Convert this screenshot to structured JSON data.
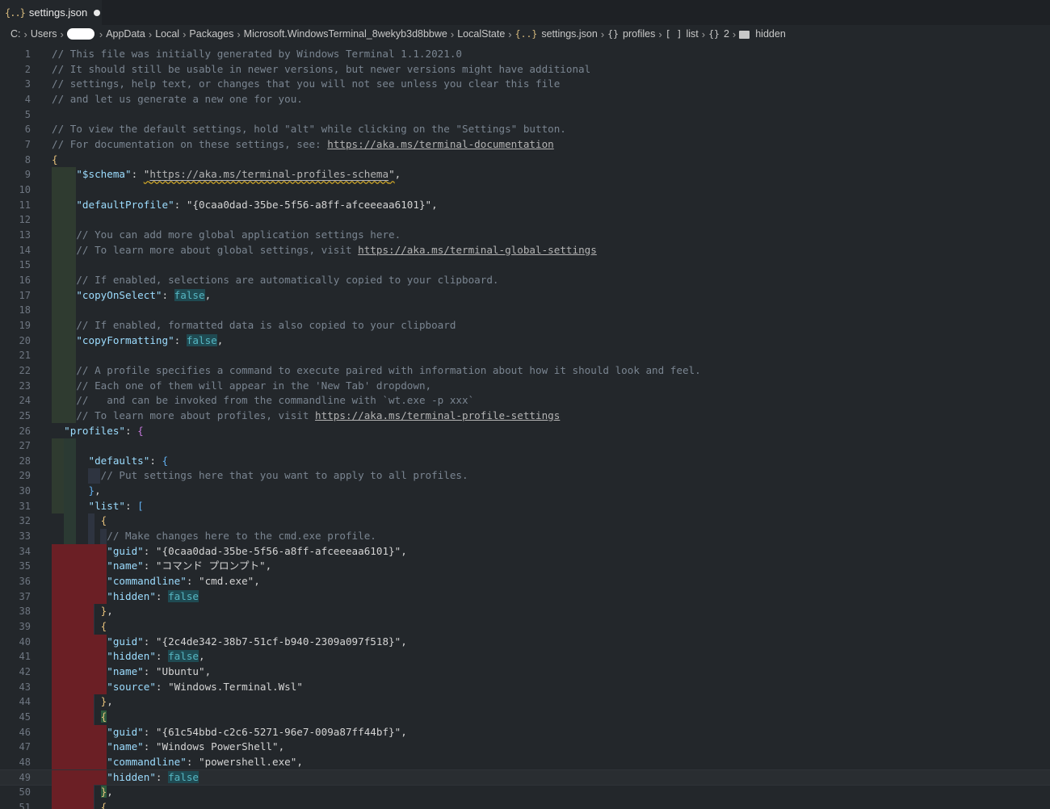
{
  "tab": {
    "icon": "{..}",
    "title": "settings.json"
  },
  "breadcrumb": {
    "drive": "C:",
    "users": "Users",
    "appdata": "AppData",
    "local": "Local",
    "packages": "Packages",
    "package": "Microsoft.WindowsTerminal_8wekyb3d8bbwe",
    "localstate": "LocalState",
    "file_icon": "{..}",
    "file": "settings.json",
    "obj_icon": "{}",
    "profiles": "profiles",
    "arr_icon": "[ ]",
    "list": "list",
    "obj2_icon": "{}",
    "index": "2",
    "hidden": "hidden"
  },
  "lines": [
    {
      "n": "1",
      "html": "<span class='c'>// This file was initially generated by Windows Terminal 1.1.2021.0</span>"
    },
    {
      "n": "2",
      "html": "<span class='c'>// It should still be usable in newer versions, but newer versions might have additional</span>"
    },
    {
      "n": "3",
      "html": "<span class='c'>// settings, help text, or changes that you will not see unless you clear this file</span>"
    },
    {
      "n": "4",
      "html": "<span class='c'>// and let us generate a new one for you.</span>"
    },
    {
      "n": "5",
      "html": ""
    },
    {
      "n": "6",
      "html": "<span class='c'>// To view the default settings, hold \"alt\" while clicking on the \"Settings\" button.</span>"
    },
    {
      "n": "7",
      "html": "<span class='c'>// For documentation on these settings, see: <span class='u'>https://aka.ms/terminal-documentation</span></span>"
    },
    {
      "n": "8",
      "html": "<span class='b'>{</span>"
    },
    {
      "n": "9",
      "html": "    <span class='k'>\"$schema\"</span>: <span class='s2 sq'>\"<span class='u'>https://aka.ms/terminal-profiles-schema</span>\"</span>,"
    },
    {
      "n": "10",
      "html": ""
    },
    {
      "n": "11",
      "html": "    <span class='k'>\"defaultProfile\"</span>: <span class='s2'>\"{0caa0dad-35be-5f56-a8ff-afceeeaa6101}\"</span>,"
    },
    {
      "n": "12",
      "html": ""
    },
    {
      "n": "13",
      "html": "    <span class='c'>// You can add more global application settings here.</span>"
    },
    {
      "n": "14",
      "html": "    <span class='c'>// To learn more about global settings, visit <span class='u'>https://aka.ms/terminal-global-settings</span></span>"
    },
    {
      "n": "15",
      "html": ""
    },
    {
      "n": "16",
      "html": "    <span class='c'>// If enabled, selections are automatically copied to your clipboard.</span>"
    },
    {
      "n": "17",
      "html": "    <span class='k'>\"copyOnSelect\"</span>: <span class='kw'>false</span>,"
    },
    {
      "n": "18",
      "html": ""
    },
    {
      "n": "19",
      "html": "    <span class='c'>// If enabled, formatted data is also copied to your clipboard</span>"
    },
    {
      "n": "20",
      "html": "    <span class='k'>\"copyFormatting\"</span>: <span class='kw'>false</span>,"
    },
    {
      "n": "21",
      "html": ""
    },
    {
      "n": "22",
      "html": "    <span class='c'>// A profile specifies a command to execute paired with information about how it should look and feel.</span>"
    },
    {
      "n": "23",
      "html": "    <span class='c'>// Each one of them will appear in the 'New Tab' dropdown,</span>"
    },
    {
      "n": "24",
      "html": "    <span class='c'>//   and can be invoked from the commandline with `wt.exe -p xxx`</span>"
    },
    {
      "n": "25",
      "html": "    <span class='c'>// To learn more about profiles, visit <span class='u'>https://aka.ms/terminal-profile-settings</span></span>"
    },
    {
      "n": "26",
      "html": "  <span class='k'>\"profiles\"</span>: <span class='bm'>{</span>"
    },
    {
      "n": "27",
      "html": ""
    },
    {
      "n": "28",
      "html": "      <span class='k'>\"defaults\"</span>: <span class='bb'>{</span>"
    },
    {
      "n": "29",
      "html": "        <span class='c'>// Put settings here that you want to apply to all profiles.</span>"
    },
    {
      "n": "30",
      "html": "      <span class='bb'>}</span>,"
    },
    {
      "n": "31",
      "html": "      <span class='k'>\"list\"</span>: <span class='bb'>[</span>"
    },
    {
      "n": "32",
      "html": "        <span class='b'>{</span>"
    },
    {
      "n": "33",
      "html": "         <span class='c'>// Make changes here to the cmd.exe profile.</span>"
    },
    {
      "n": "34",
      "html": "         <span class='k'>\"guid\"</span>: <span class='s2'>\"{0caa0dad-35be-5f56-a8ff-afceeeaa6101}\"</span>,"
    },
    {
      "n": "35",
      "html": "         <span class='k'>\"name\"</span>: <span class='s2'>\"コマンド プロンプト\"</span>,"
    },
    {
      "n": "36",
      "html": "         <span class='k'>\"commandline\"</span>: <span class='s2'>\"cmd.exe\"</span>,"
    },
    {
      "n": "37",
      "html": "         <span class='k'>\"hidden\"</span>: <span class='kw'>false</span>"
    },
    {
      "n": "38",
      "html": "        <span class='b'>}</span>,"
    },
    {
      "n": "39",
      "html": "        <span class='b'>{</span>"
    },
    {
      "n": "40",
      "html": "         <span class='k'>\"guid\"</span>: <span class='s2'>\"{2c4de342-38b7-51cf-b940-2309a097f518}\"</span>,"
    },
    {
      "n": "41",
      "html": "         <span class='k'>\"hidden\"</span>: <span class='kw'>false</span>,"
    },
    {
      "n": "42",
      "html": "         <span class='k'>\"name\"</span>: <span class='s2'>\"Ubuntu\"</span>,"
    },
    {
      "n": "43",
      "html": "         <span class='k'>\"source\"</span>: <span class='s2'>\"Windows.Terminal.Wsl\"</span>"
    },
    {
      "n": "44",
      "html": "        <span class='b'>}</span>,"
    },
    {
      "n": "45",
      "html": "        <span class='b hl'>{</span>"
    },
    {
      "n": "46",
      "html": "         <span class='k'>\"guid\"</span>: <span class='s2'>\"{61c54bbd-c2c6-5271-96e7-009a87ff44bf}\"</span>,"
    },
    {
      "n": "47",
      "html": "         <span class='k'>\"name\"</span>: <span class='s2'>\"Windows PowerShell\"</span>,"
    },
    {
      "n": "48",
      "html": "         <span class='k'>\"commandline\"</span>: <span class='s2'>\"powershell.exe\"</span>,"
    },
    {
      "n": "49",
      "html": "         <span class='k'>\"hidden\"</span>: <span class='kw'>false</span>"
    },
    {
      "n": "50",
      "html": "        <span class='b hl'>}</span>,"
    },
    {
      "n": "51",
      "html": "        <span class='b'>{</span>"
    }
  ],
  "current_line": "49"
}
